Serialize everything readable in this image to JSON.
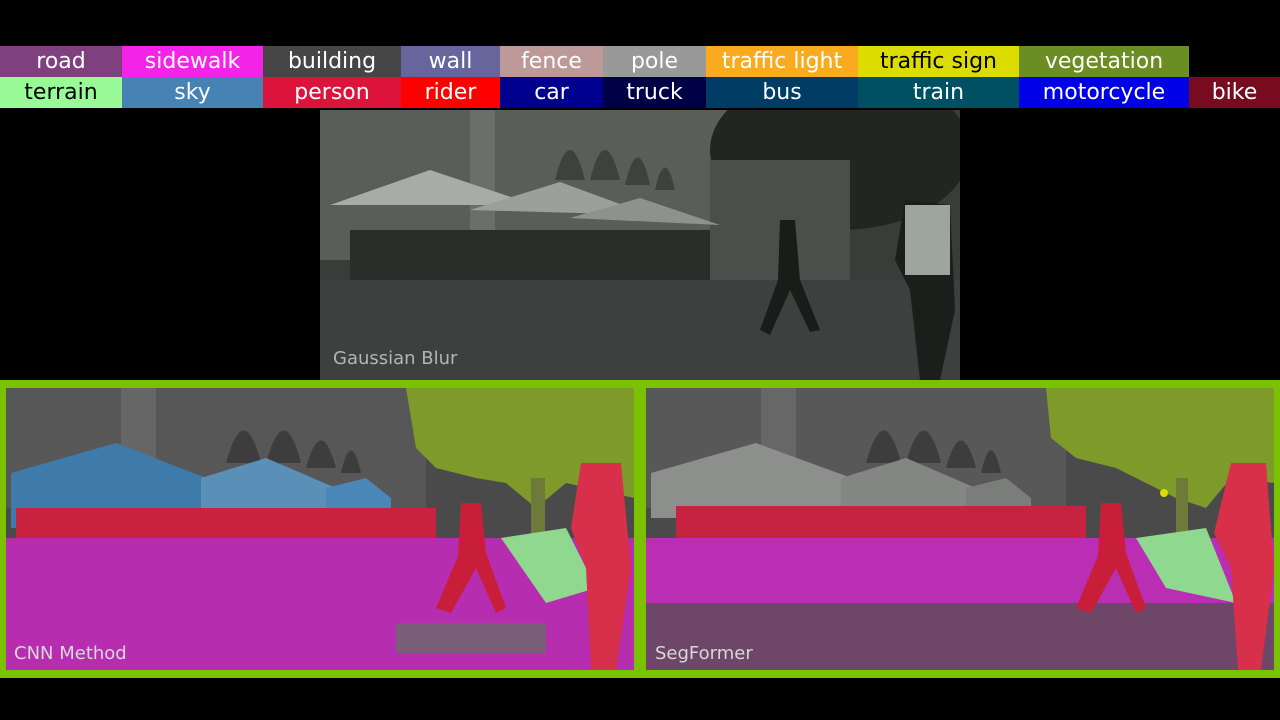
{
  "legend": {
    "row1": [
      {
        "label": "road",
        "bg": "#80407f",
        "fg": "#ffffff"
      },
      {
        "label": "sidewalk",
        "bg": "#f423e8",
        "fg": "#ffffff"
      },
      {
        "label": "building",
        "bg": "#464646",
        "fg": "#ffffff"
      },
      {
        "label": "wall",
        "bg": "#66669c",
        "fg": "#ffffff"
      },
      {
        "label": "fence",
        "bg": "#be9999",
        "fg": "#ffffff"
      },
      {
        "label": "pole",
        "bg": "#999999",
        "fg": "#ffffff"
      },
      {
        "label": "traffic light",
        "bg": "#faaa1e",
        "fg": "#ffffff"
      },
      {
        "label": "traffic sign",
        "bg": "#dcdc00",
        "fg": "#000000"
      },
      {
        "label": "vegetation",
        "bg": "#6b8e23",
        "fg": "#ffffff"
      }
    ],
    "row2": [
      {
        "label": "terrain",
        "bg": "#98fb98",
        "fg": "#000000"
      },
      {
        "label": "sky",
        "bg": "#4682b4",
        "fg": "#ffffff"
      },
      {
        "label": "person",
        "bg": "#dc143c",
        "fg": "#ffffff"
      },
      {
        "label": "rider",
        "bg": "#ff0000",
        "fg": "#ffffff"
      },
      {
        "label": "car",
        "bg": "#00008e",
        "fg": "#ffffff"
      },
      {
        "label": "truck",
        "bg": "#000046",
        "fg": "#ffffff"
      },
      {
        "label": "bus",
        "bg": "#003c64",
        "fg": "#ffffff"
      },
      {
        "label": "train",
        "bg": "#005064",
        "fg": "#ffffff"
      },
      {
        "label": "motorcycle",
        "bg": "#0000e6",
        "fg": "#ffffff"
      },
      {
        "label": "bike",
        "bg": "#770b20",
        "fg": "#ffffff"
      }
    ]
  },
  "panels": {
    "top_caption": "Gaussian Blur",
    "left_caption": "CNN Method",
    "right_caption": "SegFormer"
  },
  "colors": {
    "frame": "#7ac200",
    "background": "#000000"
  }
}
